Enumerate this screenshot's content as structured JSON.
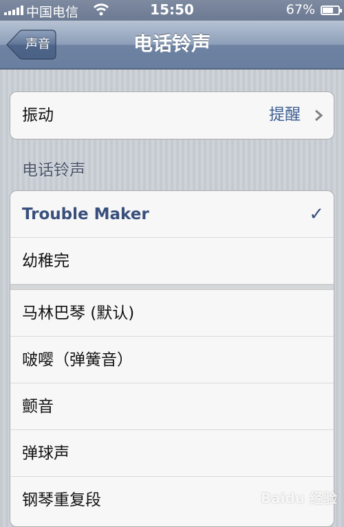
{
  "status_bar": {
    "carrier": "中国电信",
    "time": "15:50",
    "battery_percent": "67%",
    "battery_level": 0.67,
    "signal_icon": "signal-bars-icon",
    "wifi_icon": "wifi-icon"
  },
  "nav": {
    "back_label": "声音",
    "title": "电话铃声"
  },
  "vibration": {
    "label": "振动",
    "value": "提醒"
  },
  "section_header": "电话铃声",
  "ringtones": {
    "custom": [
      {
        "label": "Trouble Maker",
        "selected": true
      },
      {
        "label": "幼稚完",
        "selected": false
      }
    ],
    "builtin": [
      {
        "label": "马林巴琴 (默认)"
      },
      {
        "label": "啵嘤（弹簧音）"
      },
      {
        "label": "颤音"
      },
      {
        "label": "弹球声"
      },
      {
        "label": "钢琴重复段"
      }
    ],
    "check_mark": "✓"
  },
  "watermark": "Baidu 经验",
  "colors": {
    "accent": "#394f7c",
    "value_blue": "#3f5f93",
    "nav_bar": "#6e82a2"
  }
}
